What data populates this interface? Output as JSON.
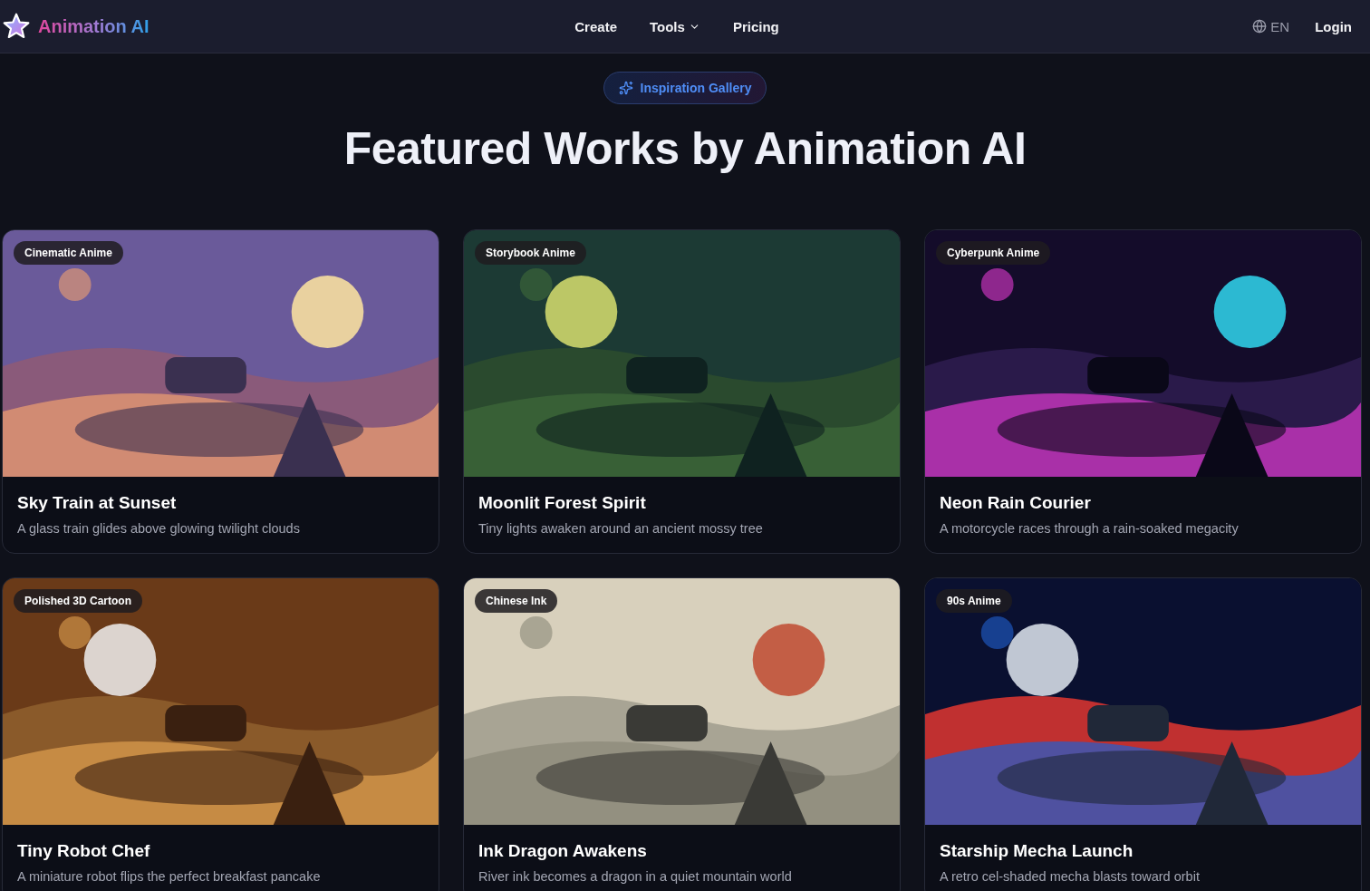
{
  "brand": {
    "name": "Animation AI"
  },
  "nav": [
    {
      "label": "Create",
      "kind": "link"
    },
    {
      "label": "Tools",
      "kind": "dropdown"
    },
    {
      "label": "Pricing",
      "kind": "link"
    }
  ],
  "language": "EN",
  "login": "Login",
  "badge": "Inspiration Gallery",
  "heading": "Featured Works by Animation AI",
  "cards": [
    {
      "tag": "Cinematic Anime",
      "title": "Sky Train at Sunset",
      "description": "A glass train glides above glowing twilight clouds"
    },
    {
      "tag": "Storybook Anime",
      "title": "Moonlit Forest Spirit",
      "description": "Tiny lights awaken around an ancient mossy tree"
    },
    {
      "tag": "Cyberpunk Anime",
      "title": "Neon Rain Courier",
      "description": "A motorcycle races through a rain-soaked megacity"
    },
    {
      "tag": "Polished 3D Cartoon",
      "title": "Tiny Robot Chef",
      "description": "A miniature robot flips the perfect breakfast pancake"
    },
    {
      "tag": "Chinese Ink",
      "title": "Ink Dragon Awakens",
      "description": "River ink becomes a dragon in a quiet mountain world"
    },
    {
      "tag": "90s Anime",
      "title": "Starship Mecha Launch",
      "description": "A retro cel-shaded mecha blasts toward orbit"
    }
  ]
}
